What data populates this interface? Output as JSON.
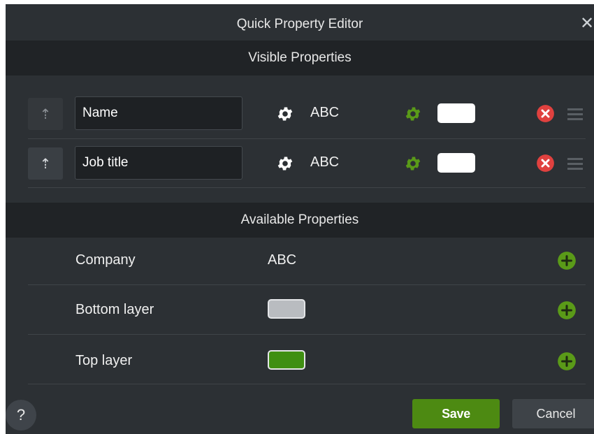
{
  "dialog": {
    "title": "Quick Property Editor",
    "close_icon": "close-icon"
  },
  "visible_properties": {
    "header": "Visible Properties",
    "rows": [
      {
        "name": "Name",
        "type": "ABC",
        "swatch_color": "#ffffff"
      },
      {
        "name": "Job title",
        "type": "ABC",
        "swatch_color": "#ffffff"
      }
    ]
  },
  "available_properties": {
    "header": "Available Properties",
    "rows": [
      {
        "name": "Company",
        "value": "ABC"
      },
      {
        "name": "Bottom layer",
        "swatch_color": "#b9bcc0"
      },
      {
        "name": "Top layer",
        "swatch_color": "#3f8f12"
      }
    ]
  },
  "footer": {
    "help_label": "?",
    "save_label": "Save",
    "cancel_label": "Cancel"
  },
  "colors": {
    "accent_green": "#4d8a12",
    "remove_red": "#e0413f",
    "panel_bg": "#2c3034",
    "header_bg": "#202326"
  }
}
